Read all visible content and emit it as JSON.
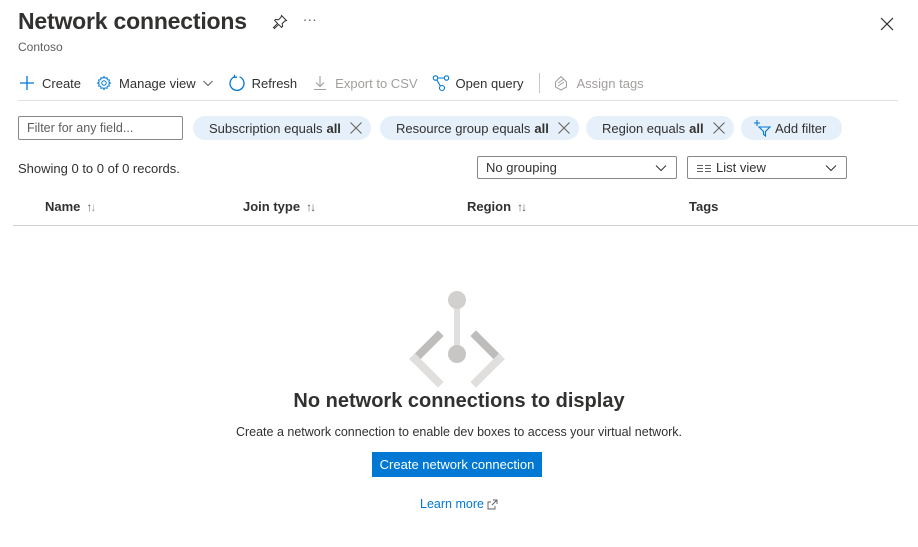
{
  "header": {
    "title": "Network connections",
    "subtitle": "Contoso",
    "pin_icon": "pin-icon",
    "more_label": "···",
    "close_icon": "close-icon"
  },
  "toolbar": {
    "create": "Create",
    "manage_view": "Manage view",
    "refresh": "Refresh",
    "export_csv": "Export to CSV",
    "open_query": "Open query",
    "assign_tags": "Assign tags"
  },
  "filters": {
    "search_placeholder": "Filter for any field...",
    "search_value": "",
    "pills": [
      {
        "label": "Subscription equals",
        "value": "all"
      },
      {
        "label": "Resource group equals",
        "value": "all"
      },
      {
        "label": "Region equals",
        "value": "all"
      }
    ],
    "add_filter": "Add filter"
  },
  "records_text": "Showing 0 to 0 of 0 records.",
  "grouping": {
    "selected": "No grouping"
  },
  "view": {
    "selected": "List view"
  },
  "table": {
    "columns": [
      {
        "label": "Name",
        "sortable": true
      },
      {
        "label": "Join type",
        "sortable": true
      },
      {
        "label": "Region",
        "sortable": true
      },
      {
        "label": "Tags",
        "sortable": false
      }
    ],
    "sort_up": "↑",
    "sort_down": "↓",
    "rows": []
  },
  "empty_state": {
    "title": "No network connections to display",
    "description": "Create a network connection to enable dev boxes to access your virtual network.",
    "button": "Create network connection",
    "link": "Learn more"
  },
  "colors": {
    "accent": "#0078d4",
    "pill_bg": "#e6f0fa",
    "text": "#323130",
    "disabled": "#a19f9d"
  }
}
